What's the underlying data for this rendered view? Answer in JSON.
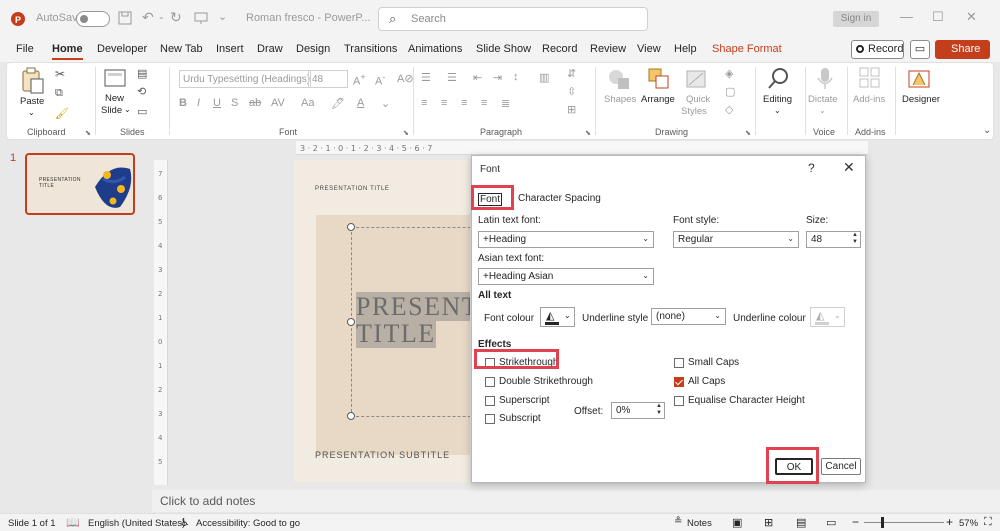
{
  "titlebar": {
    "autosave": "AutoSave",
    "file_name": "Roman fresco  -  PowerP...",
    "search_placeholder": "Search",
    "sign_in": "Sign in"
  },
  "tabs": [
    "File",
    "Home",
    "Developer",
    "New Tab",
    "Insert",
    "Draw",
    "Design",
    "Transitions",
    "Animations",
    "Slide Show",
    "Record",
    "Review",
    "View",
    "Help",
    "Shape Format"
  ],
  "active_tab": "Home",
  "top_buttons": {
    "record": "Record",
    "share": "Share"
  },
  "ribbon": {
    "paste": "Paste",
    "new_slide_line1": "New",
    "new_slide_line2": "Slide",
    "font_name": "Urdu Typesetting (Headings)",
    "font_size": "48",
    "shapes": "Shapes",
    "arrange": "Arrange",
    "quick_styles_line1": "Quick",
    "quick_styles_line2": "Styles",
    "editing": "Editing",
    "dictate": "Dictate",
    "addins": "Add-ins",
    "designer": "Designer",
    "groups": {
      "clipboard": "Clipboard",
      "slides": "Slides",
      "font": "Font",
      "paragraph": "Paragraph",
      "drawing": "Drawing",
      "voice": "Voice",
      "addins": "Add-ins"
    }
  },
  "thumbnail": {
    "number": "1",
    "title_line1": "PRESENTATION",
    "title_line2": "TITLE"
  },
  "slide": {
    "caption": "PRESENTATION TITLE",
    "title_line1": "PRESENT",
    "title_line2": "TITLE",
    "subtitle": "PRESENTATION SUBTITLE"
  },
  "notes_placeholder": "Click to add notes",
  "statusbar": {
    "slide_count": "Slide 1 of 1",
    "language": "English (United States)",
    "accessibility": "Accessibility: Good to go",
    "notes": "Notes",
    "zoom": "57%"
  },
  "dialog": {
    "title": "Font",
    "tabs": {
      "font": "Font",
      "character_spacing": "Character Spacing"
    },
    "latin_font_label": "Latin text font:",
    "latin_font_value": "+Heading",
    "font_style_label": "Font style:",
    "font_style_value": "Regular",
    "size_label": "Size:",
    "size_value": "48",
    "asian_font_label": "Asian text font:",
    "asian_font_value": "+Heading Asian",
    "all_text": "All text",
    "font_colour": "Font colour",
    "underline_style_label": "Underline style",
    "underline_style_value": "(none)",
    "underline_colour": "Underline colour",
    "effects": "Effects",
    "effects_left": [
      {
        "label": "Strikethrough",
        "checked": false
      },
      {
        "label": "Double Strikethrough",
        "checked": false
      },
      {
        "label": "Superscript",
        "checked": false
      },
      {
        "label": "Subscript",
        "checked": false
      }
    ],
    "effects_right": [
      {
        "label": "Small Caps",
        "checked": false
      },
      {
        "label": "All Caps",
        "checked": true
      },
      {
        "label": "Equalise Character Height",
        "checked": false
      }
    ],
    "offset_label": "Offset:",
    "offset_value": "0%",
    "ok": "OK",
    "cancel": "Cancel"
  },
  "colors": {
    "accent": "#c43e1c",
    "highlight": "#e0434f",
    "slide_bg": "#f2ebe1",
    "slide_panel": "#e8d9c6"
  }
}
